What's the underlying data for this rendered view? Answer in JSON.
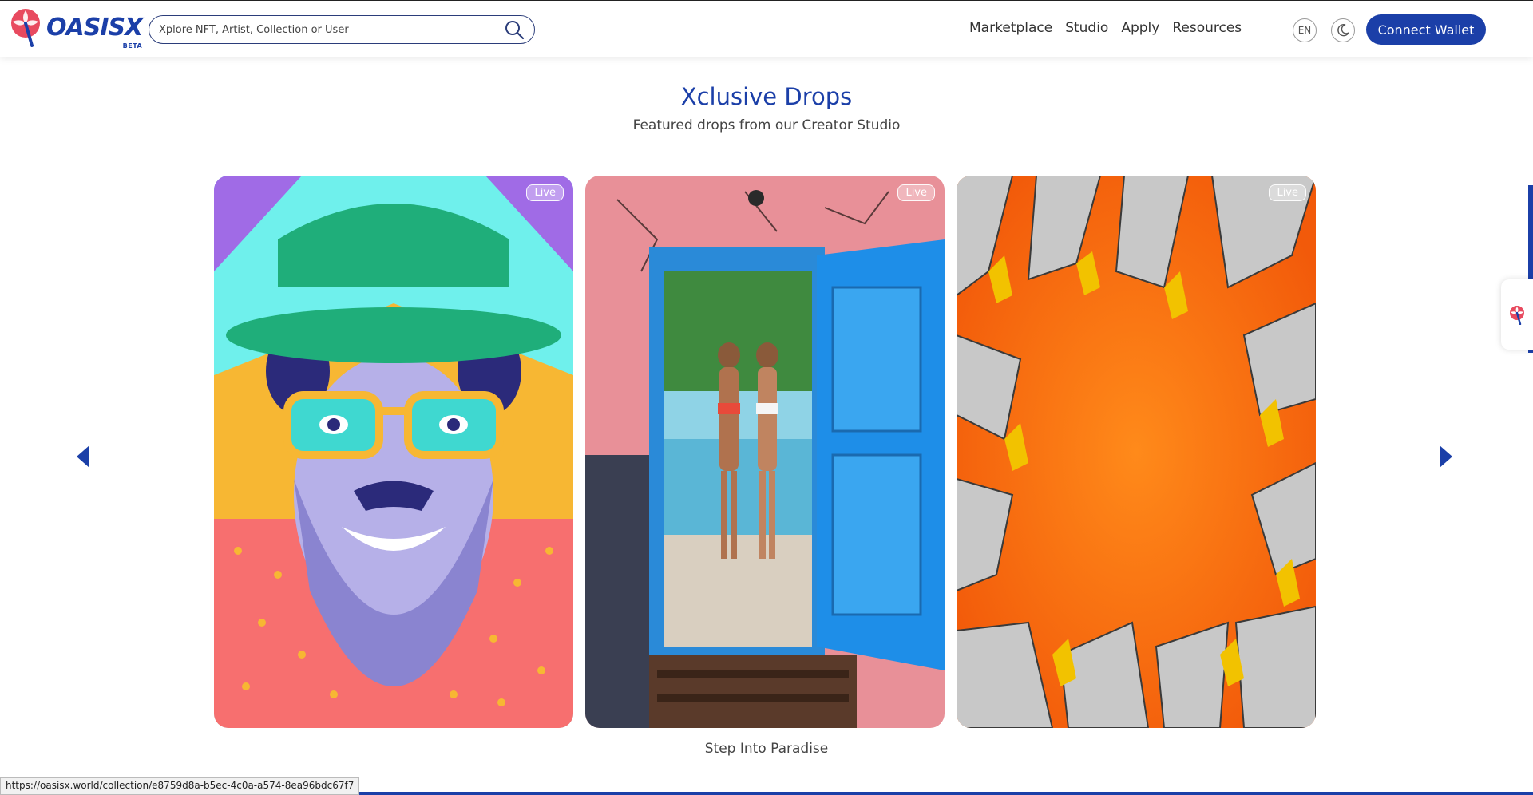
{
  "header": {
    "logo_text": "OASISX",
    "logo_beta": "BETA",
    "search_placeholder": "Xplore NFT, Artist, Collection or User",
    "nav": [
      "Marketplace",
      "Studio",
      "Apply",
      "Resources"
    ],
    "lang": "EN",
    "connect_label": "Connect Wallet"
  },
  "section": {
    "title": "Xclusive Drops",
    "subtitle": "Featured drops from our Creator Studio"
  },
  "cards": [
    {
      "badge": "Live"
    },
    {
      "badge": "Live"
    },
    {
      "badge": "Live"
    }
  ],
  "caption": "Step Into Paradise",
  "status_url": "https://oasisx.world/collection/e8759d8a-b5ec-4c0a-a574-8ea96bdc67f7",
  "colors": {
    "brand": "#1b3fa8",
    "live_badge_border": "#ffffff"
  },
  "icons": [
    "palm-logo-icon",
    "search-icon",
    "moon-icon",
    "chevron-left-icon",
    "chevron-right-icon"
  ]
}
